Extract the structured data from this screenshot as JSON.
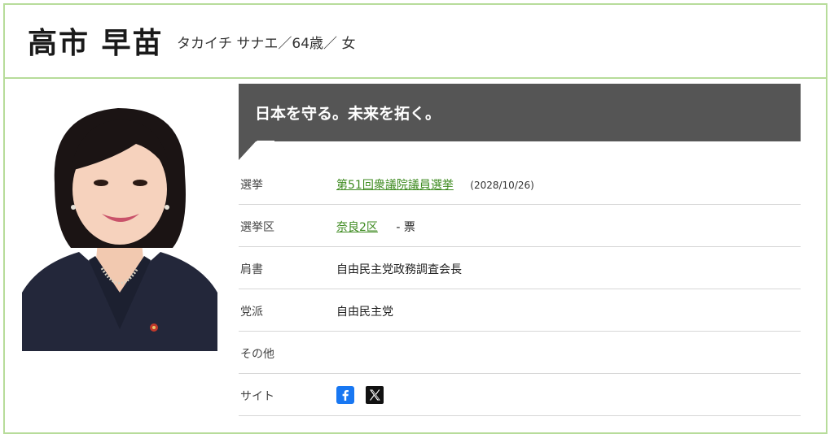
{
  "profile": {
    "name": "高市 早苗",
    "kana_age_gender": "タカイチ サナエ／64歳／ 女"
  },
  "slogan": "日本を守る。未来を拓く。",
  "details": {
    "election": {
      "label": "選挙",
      "value": "第51回衆議院議員選挙",
      "date": "(2028/10/26)"
    },
    "district": {
      "label": "選挙区",
      "value": "奈良2区",
      "votes": "- 票"
    },
    "title": {
      "label": "肩書",
      "value": "自由民主党政務調査会長"
    },
    "party": {
      "label": "党派",
      "value": "自由民主党"
    },
    "other": {
      "label": "その他",
      "value": ""
    },
    "site": {
      "label": "サイト",
      "icons": [
        "facebook-icon",
        "x-icon"
      ]
    }
  },
  "colors": {
    "accent_border": "#b7dc9a",
    "link": "#3d8a1f",
    "slogan_bg": "#555555",
    "facebook_blue": "#1877f2"
  }
}
